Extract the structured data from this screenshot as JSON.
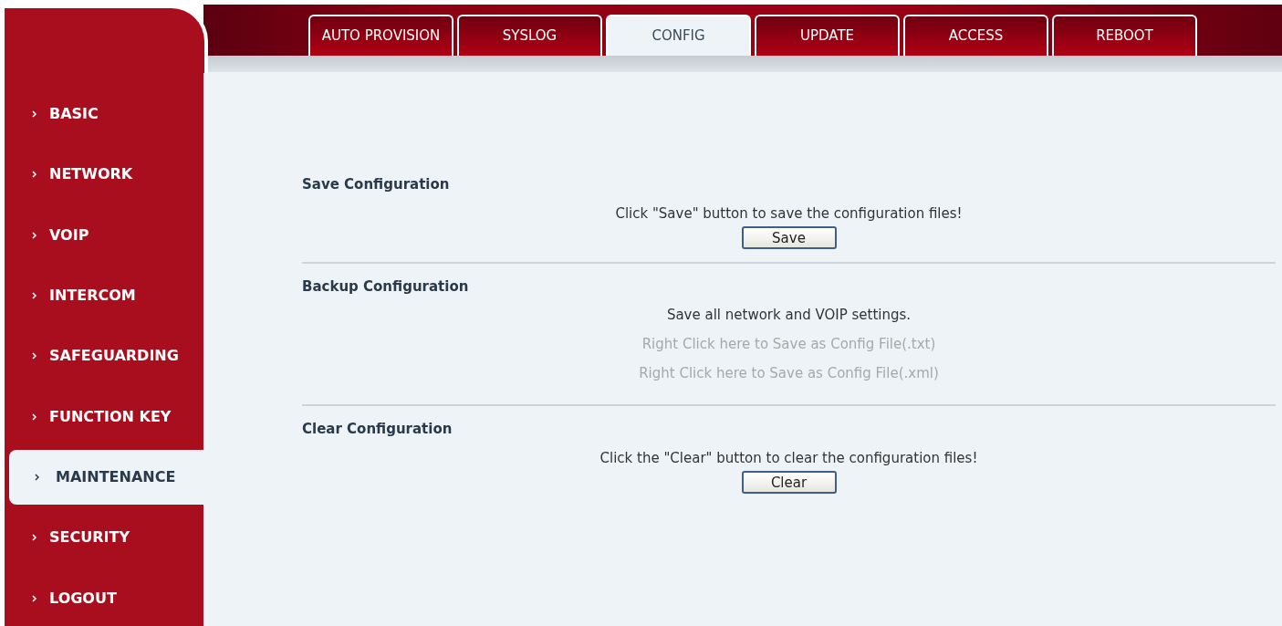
{
  "tabs": [
    {
      "label": "AUTO PROVISION",
      "selected": false
    },
    {
      "label": "SYSLOG",
      "selected": false
    },
    {
      "label": "CONFIG",
      "selected": true
    },
    {
      "label": "UPDATE",
      "selected": false
    },
    {
      "label": "ACCESS",
      "selected": false
    },
    {
      "label": "REBOOT",
      "selected": false
    }
  ],
  "sidebar": {
    "items": [
      {
        "label": "BASIC",
        "selected": false
      },
      {
        "label": "NETWORK",
        "selected": false
      },
      {
        "label": "VOIP",
        "selected": false
      },
      {
        "label": "INTERCOM",
        "selected": false
      },
      {
        "label": "SAFEGUARDING",
        "selected": false
      },
      {
        "label": "FUNCTION KEY",
        "selected": false
      },
      {
        "label": "MAINTENANCE",
        "selected": true
      },
      {
        "label": "SECURITY",
        "selected": false
      },
      {
        "label": "LOGOUT",
        "selected": false
      }
    ]
  },
  "sections": [
    {
      "title": "Save Configuration",
      "lines": [
        {
          "kind": "text",
          "text": "Click \"Save\" button to save the configuration files!"
        }
      ],
      "button": "Save"
    },
    {
      "title": "Backup Configuration",
      "lines": [
        {
          "kind": "text",
          "text": "Save all network and VOIP settings."
        },
        {
          "kind": "link",
          "text": "Right Click here to Save as Config File(.txt)"
        },
        {
          "kind": "link",
          "text": "Right Click here to Save as Config File(.xml)"
        }
      ]
    },
    {
      "title": "Clear Configuration",
      "lines": [
        {
          "kind": "text",
          "text": "Click the \"Clear\" button to clear the configuration files!"
        }
      ],
      "button": "Clear"
    }
  ]
}
